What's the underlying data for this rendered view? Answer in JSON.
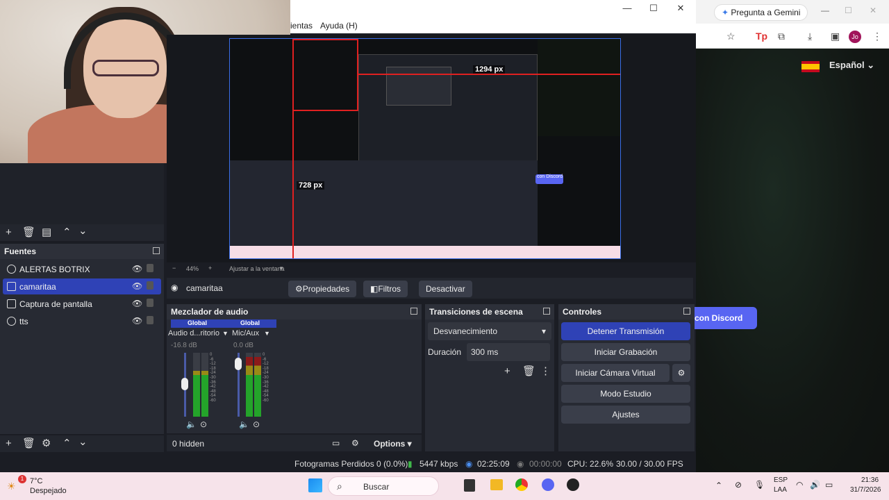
{
  "obs": {
    "menu": {
      "tools_partial": "ientas",
      "help": "Ayuda (H)"
    },
    "window_controls": {
      "minimize": "—",
      "maximize": "☐",
      "close": "✕"
    },
    "preview": {
      "label_width": "1294 px",
      "label_height": "728 px",
      "zoom": "44%",
      "fit_label": "Ajustar a la ventana",
      "inner_discord": "con Discord"
    },
    "sources": {
      "title": "Fuentes",
      "items": [
        {
          "label": "ALERTAS BOTRIX",
          "icon": "globe-icon"
        },
        {
          "label": "camaritaa",
          "icon": "camera-icon",
          "selected": true
        },
        {
          "label": "Captura de pantalla",
          "icon": "monitor-icon"
        },
        {
          "label": "tts",
          "icon": "globe-icon"
        }
      ]
    },
    "context": {
      "source": "camaritaa",
      "properties": "Propiedades",
      "filters": "Filtros",
      "deactivate": "Desactivar"
    },
    "mixer": {
      "title": "Mezclador de audio",
      "channels": [
        {
          "scope": "Global",
          "name": "Audio d...ritorio",
          "db": "-16.8 dB",
          "level": 0.52
        },
        {
          "scope": "Global",
          "name": "Mic/Aux",
          "db": "0.0 dB",
          "level": 0.9
        }
      ],
      "scale": [
        "0",
        "-6",
        "-12",
        "-18",
        "-24",
        "-30",
        "-36",
        "-42",
        "-48",
        "-54",
        "-60"
      ],
      "hidden": "0 hidden",
      "options": "Options"
    },
    "transitions": {
      "title": "Transiciones de escena",
      "selected": "Desvanecimiento",
      "duration_label": "Duración",
      "duration_value": "300 ms"
    },
    "controls": {
      "title": "Controles",
      "stop_stream": "Detener Transmisión",
      "start_recording": "Iniciar Grabación",
      "start_virtual_cam": "Iniciar Cámara Virtual",
      "studio_mode": "Modo Estudio",
      "settings": "Ajustes"
    },
    "status": {
      "dropped_frames": "Fotogramas Perdidos 0 (0.0%)",
      "bitrate": "5447 kbps",
      "stream_time": "02:25:09",
      "rec_time": "00:00:00",
      "cpu": "CPU: 22.6%",
      "fps": "30.00 / 30.00 FPS"
    }
  },
  "browser": {
    "gemini": "Pregunta a Gemini",
    "avatar": "Jo",
    "language": "Español",
    "discord_button": "con Discord"
  },
  "taskbar": {
    "weather_temp": "7°C",
    "weather_desc": "Despejado",
    "notification_count": "1",
    "search_placeholder": "Buscar",
    "lang": "ESP",
    "lang_sub": "LAA",
    "time": "21:36",
    "date": "31/7/2026"
  },
  "colors": {
    "accent": "#2f42b6",
    "discord": "#5865f2",
    "record_red": "#e02020"
  }
}
